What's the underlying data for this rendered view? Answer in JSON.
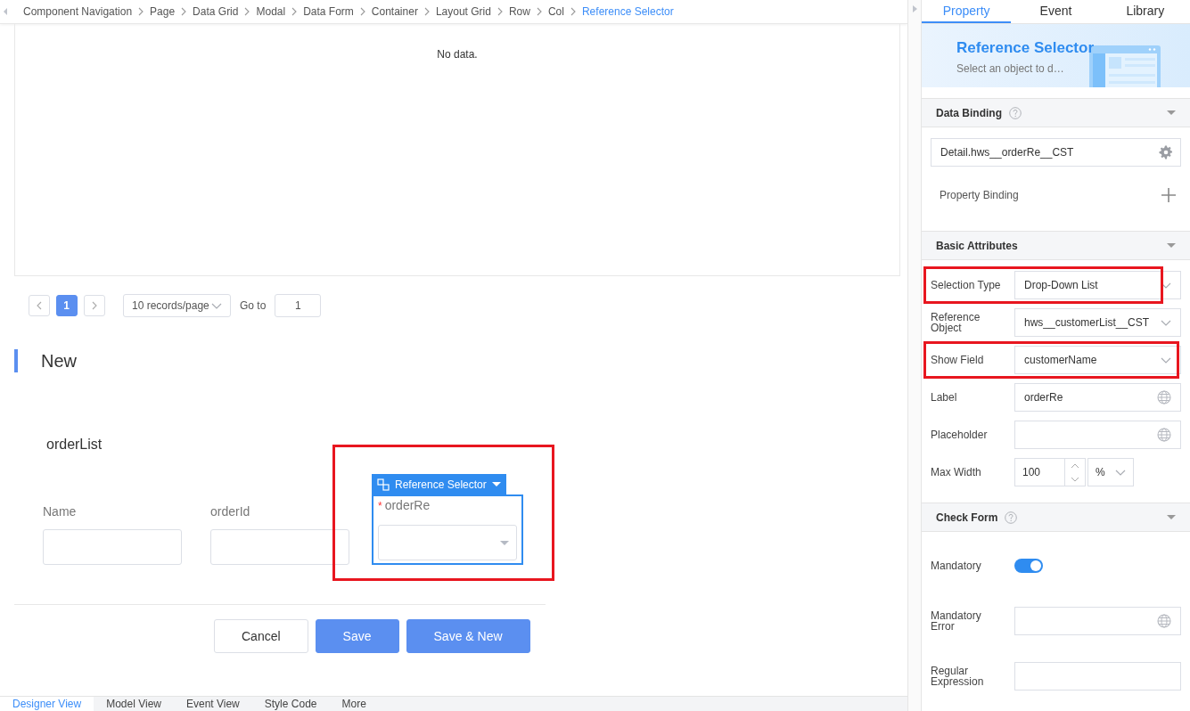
{
  "breadcrumb": [
    {
      "label": "Component Navigation",
      "current": false
    },
    {
      "label": "Page",
      "current": false
    },
    {
      "label": "Data Grid",
      "current": false
    },
    {
      "label": "Modal",
      "current": false
    },
    {
      "label": "Data Form",
      "current": false
    },
    {
      "label": "Container",
      "current": false
    },
    {
      "label": "Layout Grid",
      "current": false
    },
    {
      "label": "Row",
      "current": false
    },
    {
      "label": "Col",
      "current": false
    },
    {
      "label": "Reference Selector",
      "current": true
    }
  ],
  "canvas": {
    "table": {
      "empty_text": "No data."
    },
    "pagination": {
      "pages": [
        {
          "label": "1",
          "selected": true
        }
      ],
      "page_size": "10 records/page",
      "goto_label": "Go to",
      "goto_value": "1"
    },
    "section_title": "New",
    "group_title": "orderList",
    "fields": [
      {
        "kind": "text",
        "label": "Name"
      },
      {
        "kind": "text",
        "label": "orderId"
      },
      {
        "kind": "reference",
        "label": "orderRe",
        "required_mark": "*",
        "highlighted": true,
        "component_tag": "Reference Selector"
      }
    ],
    "buttons": [
      {
        "label": "Cancel",
        "primary": false
      },
      {
        "label": "Save",
        "primary": true
      },
      {
        "label": "Save & New",
        "primary": true
      }
    ]
  },
  "bottom_tabs": [
    {
      "label": "Designer View",
      "selected": true
    },
    {
      "label": "Model View",
      "selected": false
    },
    {
      "label": "Event View",
      "selected": false
    },
    {
      "label": "Style Code",
      "selected": false
    },
    {
      "label": "More",
      "selected": false
    }
  ],
  "panel": {
    "tabs": [
      {
        "label": "Property",
        "selected": true
      },
      {
        "label": "Event",
        "selected": false
      },
      {
        "label": "Library",
        "selected": false
      }
    ],
    "header": {
      "title": "Reference Selector",
      "subtitle": "Select an object to d…"
    },
    "sections": [
      {
        "title": "Data Binding",
        "help": true,
        "rows": [
          {
            "kind": "binding",
            "value": "Detail.hws__orderRe__CST"
          },
          {
            "kind": "add",
            "label": "Property Binding"
          }
        ]
      },
      {
        "title": "Basic Attributes",
        "rows": [
          {
            "kind": "select",
            "label": "Selection Type",
            "value": "Drop-Down List",
            "highlighted": true
          },
          {
            "kind": "select",
            "label": "Reference Object",
            "value": "hws__customerList__CST"
          },
          {
            "kind": "select",
            "label": "Show Field",
            "value": "customerName",
            "highlighted": true
          },
          {
            "kind": "i18n",
            "label": "Label",
            "value": "orderRe"
          },
          {
            "kind": "i18n",
            "label": "Placeholder"
          },
          {
            "kind": "number",
            "label": "Max Width",
            "value": "100",
            "unit": "%"
          }
        ]
      },
      {
        "title": "Check Form",
        "help": true,
        "rows": [
          {
            "kind": "toggle",
            "label": "Mandatory",
            "on": true
          },
          {
            "kind": "i18n",
            "label": "Mandatory Error"
          },
          {
            "kind": "input",
            "label": "Regular Expression"
          }
        ]
      }
    ]
  }
}
